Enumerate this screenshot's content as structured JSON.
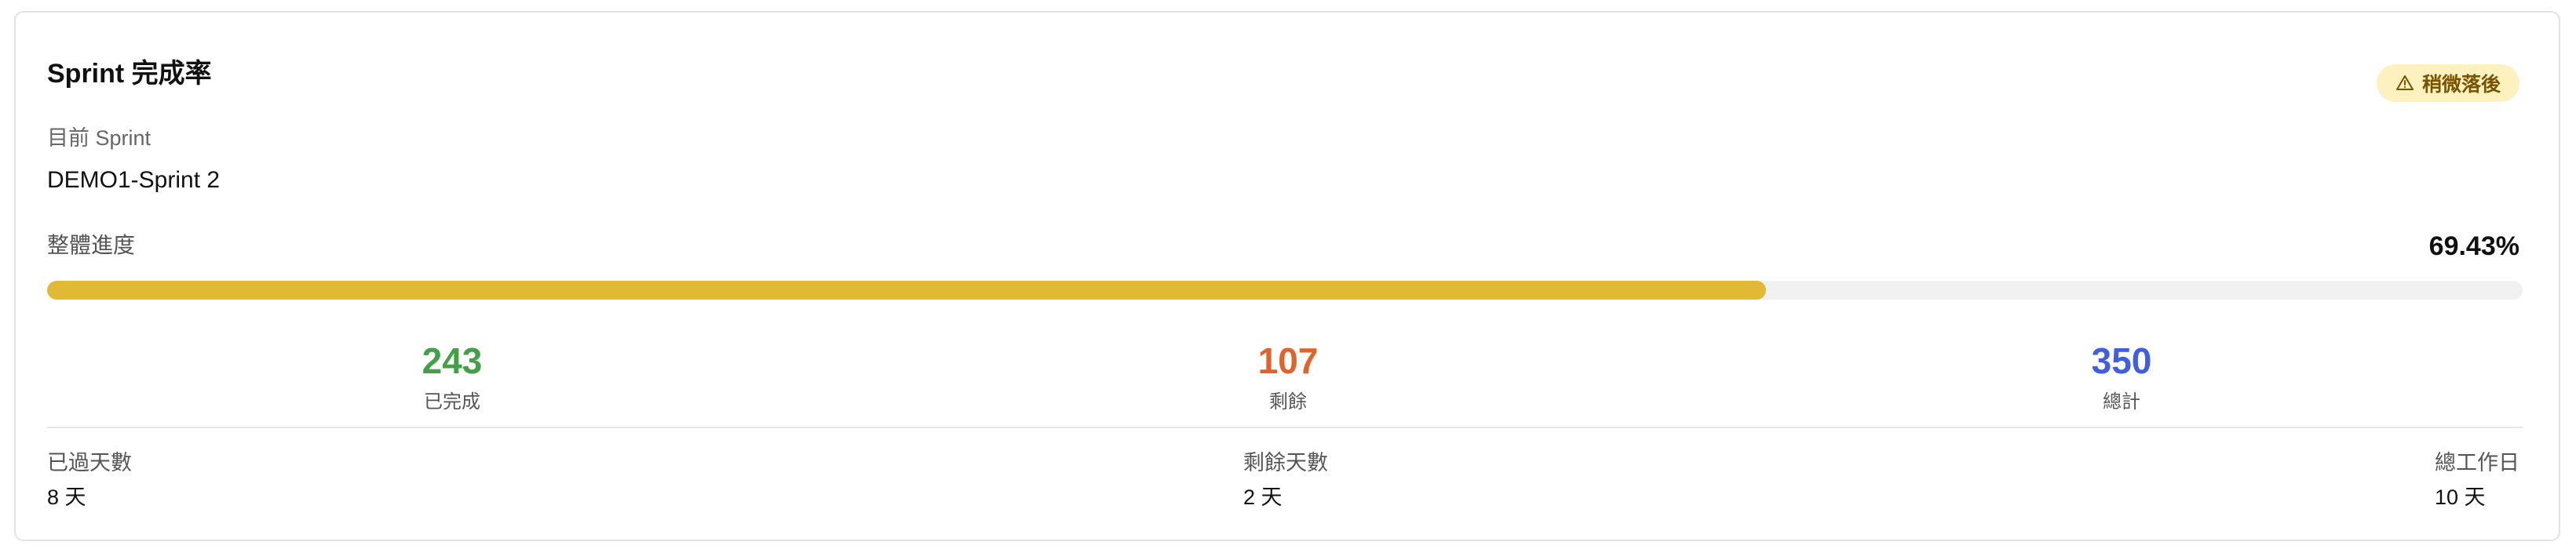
{
  "card": {
    "title": "Sprint 完成率",
    "status_badge": {
      "icon": "warning-icon",
      "label": "稍微落後",
      "background": "#fdf1bf",
      "text_color": "#7a5300"
    },
    "sprint": {
      "label": "目前 Sprint",
      "value": "DEMO1-Sprint 2"
    },
    "progress": {
      "label": "整體進度",
      "percent_text": "69.43%",
      "fraction": 0.6943,
      "fill_color": "#e1b935"
    },
    "stats": {
      "completed": {
        "value": "243",
        "label": "已完成",
        "color": "#43a047"
      },
      "remaining": {
        "value": "107",
        "label": "剩餘",
        "color": "#e1622a"
      },
      "total": {
        "value": "350",
        "label": "總計",
        "color": "#3f5ee0"
      }
    },
    "days": {
      "elapsed": {
        "label": "已過天數",
        "value": "8 天"
      },
      "remaining": {
        "label": "剩餘天數",
        "value": "2 天"
      },
      "total": {
        "label": "總工作日",
        "value": "10 天"
      }
    }
  }
}
